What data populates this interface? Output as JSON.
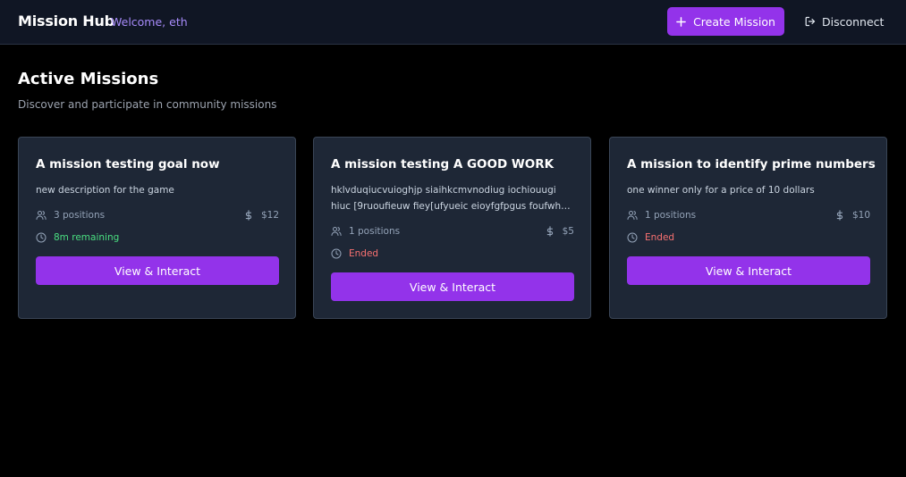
{
  "header": {
    "brand": "Mission Hub",
    "welcome": "Welcome, eth",
    "create_label": "Create Mission",
    "disconnect_label": "Disconnect"
  },
  "main": {
    "title": "Active Missions",
    "subtitle": "Discover and participate in community missions"
  },
  "missions": [
    {
      "title": "A mission testing goal now",
      "description": "new description for the game",
      "positions": "3 positions",
      "reward": "$12",
      "status": "8m remaining",
      "status_type": "active",
      "button_label": "View & Interact"
    },
    {
      "title": "A mission testing A GOOD WORK",
      "description": "hklvduqiucvuioghjp siaihkcmvnodiug iochiouugi hiuc [9ruoufieuw fiey[ufyueic eioyfgfpgus foufwhr u ogwhfi",
      "positions": "1 positions",
      "reward": "$5",
      "status": "Ended",
      "status_type": "ended",
      "button_label": "View & Interact"
    },
    {
      "title": "A mission to identify prime numbers",
      "description": "one winner only for a price of 10 dollars",
      "positions": "1 positions",
      "reward": "$10",
      "status": "Ended",
      "status_type": "ended",
      "button_label": "View & Interact"
    }
  ],
  "icons": {
    "create": "plus-icon",
    "disconnect": "logout-icon",
    "positions": "users-icon",
    "reward": "dollar-icon",
    "status": "clock-icon"
  },
  "colors": {
    "accent": "#9333ea",
    "welcome": "#a78bfa",
    "active": "#4ade80",
    "ended": "#f87171"
  }
}
